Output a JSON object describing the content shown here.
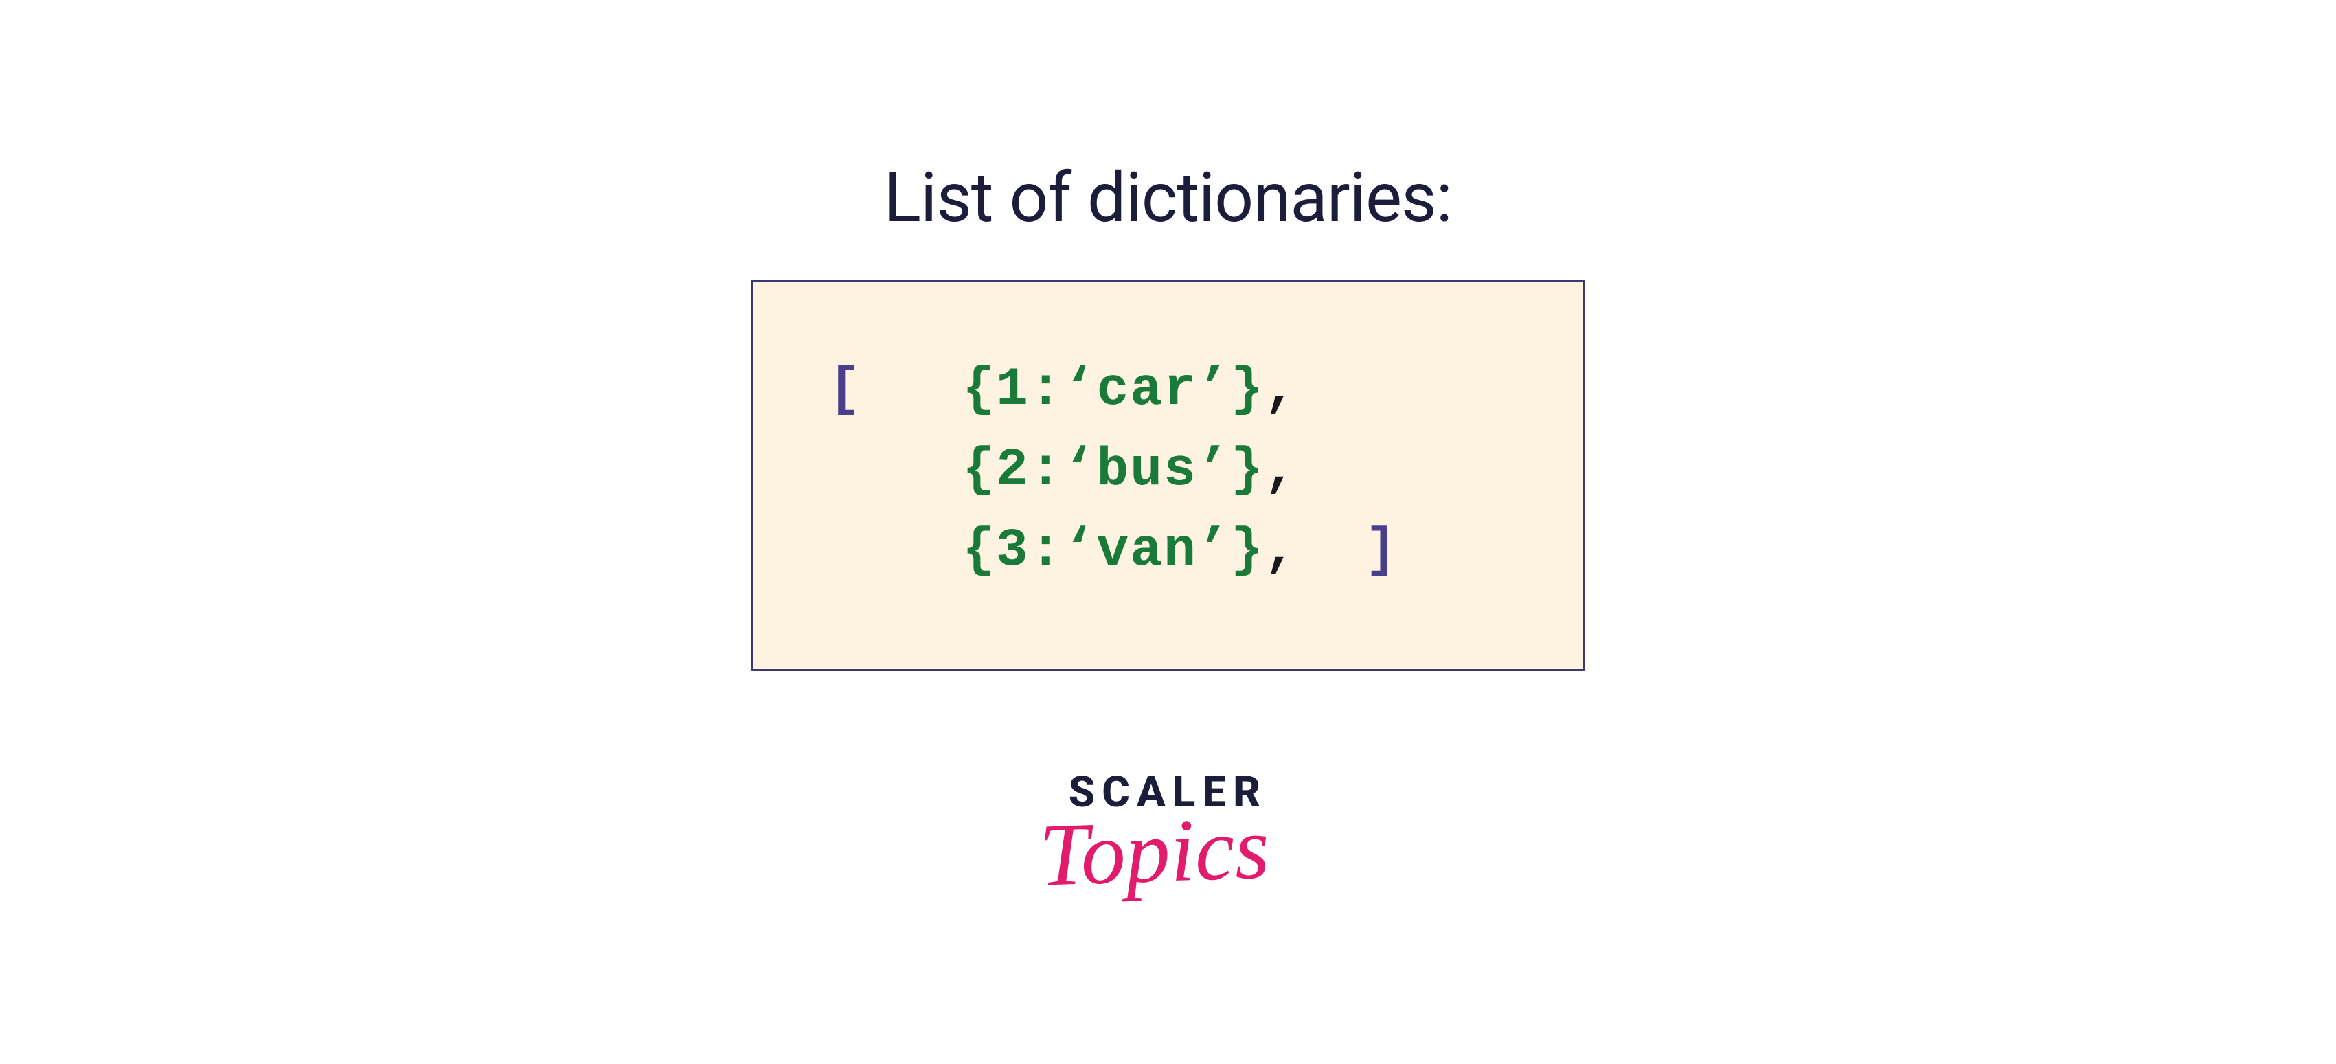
{
  "title": "List of dictionaries:",
  "code": {
    "open_bracket": "[",
    "close_bracket": "]",
    "entries": [
      {
        "dict": "{1:‘car’}",
        "comma": ","
      },
      {
        "dict": "{2:‘bus’}",
        "comma": ","
      },
      {
        "dict": "{3:‘van’}",
        "comma": ","
      }
    ]
  },
  "logo": {
    "line1": "SCALER",
    "line2": "Topics"
  }
}
